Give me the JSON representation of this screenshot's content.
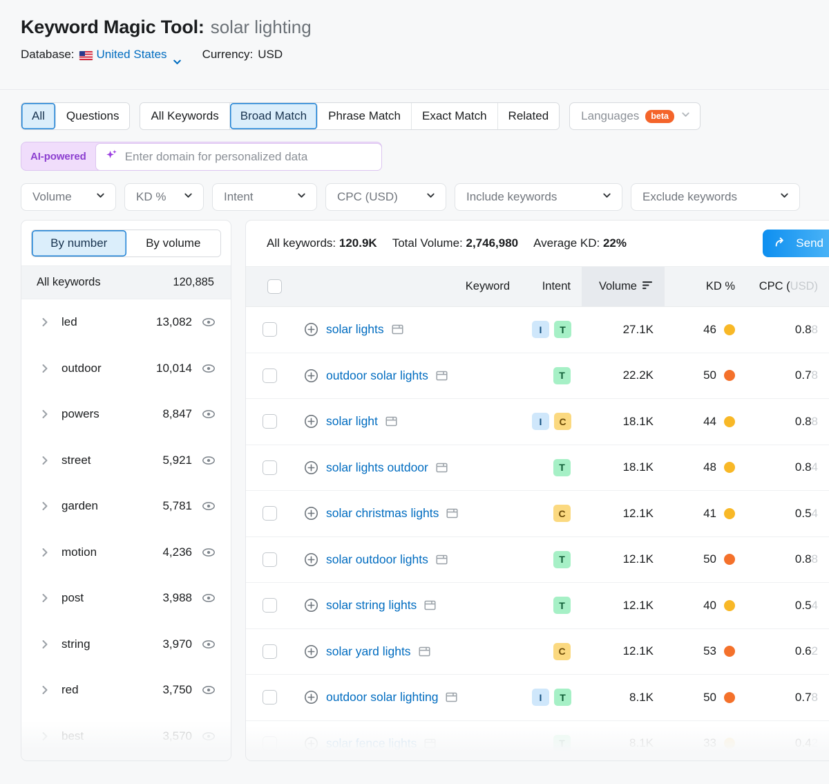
{
  "header": {
    "title": "Keyword Magic Tool:",
    "query": "solar lighting",
    "database_label": "Database:",
    "database_value": "United States",
    "currency_label": "Currency:",
    "currency_value": "USD",
    "flag_icon": "us-flag-icon"
  },
  "tabs": {
    "group1": [
      {
        "label": "All",
        "active": true
      },
      {
        "label": "Questions",
        "active": false
      }
    ],
    "group2": [
      {
        "label": "All Keywords",
        "active": false
      },
      {
        "label": "Broad Match",
        "active": true
      },
      {
        "label": "Phrase Match",
        "active": false
      },
      {
        "label": "Exact Match",
        "active": false
      },
      {
        "label": "Related",
        "active": false
      }
    ],
    "languages": {
      "label": "Languages",
      "badge": "beta"
    }
  },
  "ai": {
    "label": "AI-powered",
    "placeholder": "Enter domain for personalized data",
    "icon": "sparkle-icon"
  },
  "filters": [
    {
      "label": "Volume"
    },
    {
      "label": "KD %"
    },
    {
      "label": "Intent"
    },
    {
      "label": "CPC (USD)"
    },
    {
      "label": "Include keywords"
    },
    {
      "label": "Exclude keywords"
    }
  ],
  "sidebar": {
    "toggle": [
      {
        "label": "By number",
        "active": true
      },
      {
        "label": "By volume",
        "active": false
      }
    ],
    "all_keywords_label": "All keywords",
    "all_keywords_count": "120,885",
    "groups": [
      {
        "name": "led",
        "count": "13,082"
      },
      {
        "name": "outdoor",
        "count": "10,014"
      },
      {
        "name": "powers",
        "count": "8,847"
      },
      {
        "name": "street",
        "count": "5,921"
      },
      {
        "name": "garden",
        "count": "5,781"
      },
      {
        "name": "motion",
        "count": "4,236"
      },
      {
        "name": "post",
        "count": "3,988"
      },
      {
        "name": "string",
        "count": "3,970"
      },
      {
        "name": "red",
        "count": "3,750"
      },
      {
        "name": "best",
        "count": "3,570"
      }
    ]
  },
  "summary": {
    "all_keywords_label": "All keywords:",
    "all_keywords_value": "120.9K",
    "total_volume_label": "Total Volume:",
    "total_volume_value": "2,746,980",
    "average_kd_label": "Average KD:",
    "average_kd_value": "22%",
    "send_label": "Send"
  },
  "table": {
    "columns": {
      "keyword": "Keyword",
      "intent": "Intent",
      "volume": "Volume",
      "kd": "KD %",
      "cpc_main": "CPC (",
      "cpc_unit": "USD)"
    },
    "sorted_column": "volume",
    "rows": [
      {
        "keyword": "solar lights",
        "intents": [
          "I",
          "T"
        ],
        "volume": "27.1K",
        "kd": "46",
        "kd_color": "#f8b827",
        "cpc": "0.88"
      },
      {
        "keyword": "outdoor solar lights",
        "intents": [
          "T"
        ],
        "volume": "22.2K",
        "kd": "50",
        "kd_color": "#f4712b",
        "cpc": "0.78"
      },
      {
        "keyword": "solar light",
        "intents": [
          "I",
          "C"
        ],
        "volume": "18.1K",
        "kd": "44",
        "kd_color": "#f8b827",
        "cpc": "0.88"
      },
      {
        "keyword": "solar lights outdoor",
        "intents": [
          "T"
        ],
        "volume": "18.1K",
        "kd": "48",
        "kd_color": "#f8b827",
        "cpc": "0.84"
      },
      {
        "keyword": "solar christmas lights",
        "intents": [
          "C"
        ],
        "volume": "12.1K",
        "kd": "41",
        "kd_color": "#f8b827",
        "cpc": "0.54"
      },
      {
        "keyword": "solar outdoor lights",
        "intents": [
          "T"
        ],
        "volume": "12.1K",
        "kd": "50",
        "kd_color": "#f4712b",
        "cpc": "0.88"
      },
      {
        "keyword": "solar string lights",
        "intents": [
          "T"
        ],
        "volume": "12.1K",
        "kd": "40",
        "kd_color": "#f8b827",
        "cpc": "0.54"
      },
      {
        "keyword": "solar yard lights",
        "intents": [
          "C"
        ],
        "volume": "12.1K",
        "kd": "53",
        "kd_color": "#f4712b",
        "cpc": "0.62"
      },
      {
        "keyword": "outdoor solar lighting",
        "intents": [
          "I",
          "T"
        ],
        "volume": "8.1K",
        "kd": "50",
        "kd_color": "#f4712b",
        "cpc": "0.78"
      },
      {
        "keyword": "solar fence lights",
        "intents": [
          "T"
        ],
        "volume": "8.1K",
        "kd": "33",
        "kd_color": "#f8cf6a",
        "cpc": "0.42"
      }
    ]
  },
  "colors": {
    "link": "#006cc0",
    "accent_blue": "#1a7fd4",
    "ai_purple": "#8c3fd0",
    "beta_orange": "#f4642a"
  }
}
